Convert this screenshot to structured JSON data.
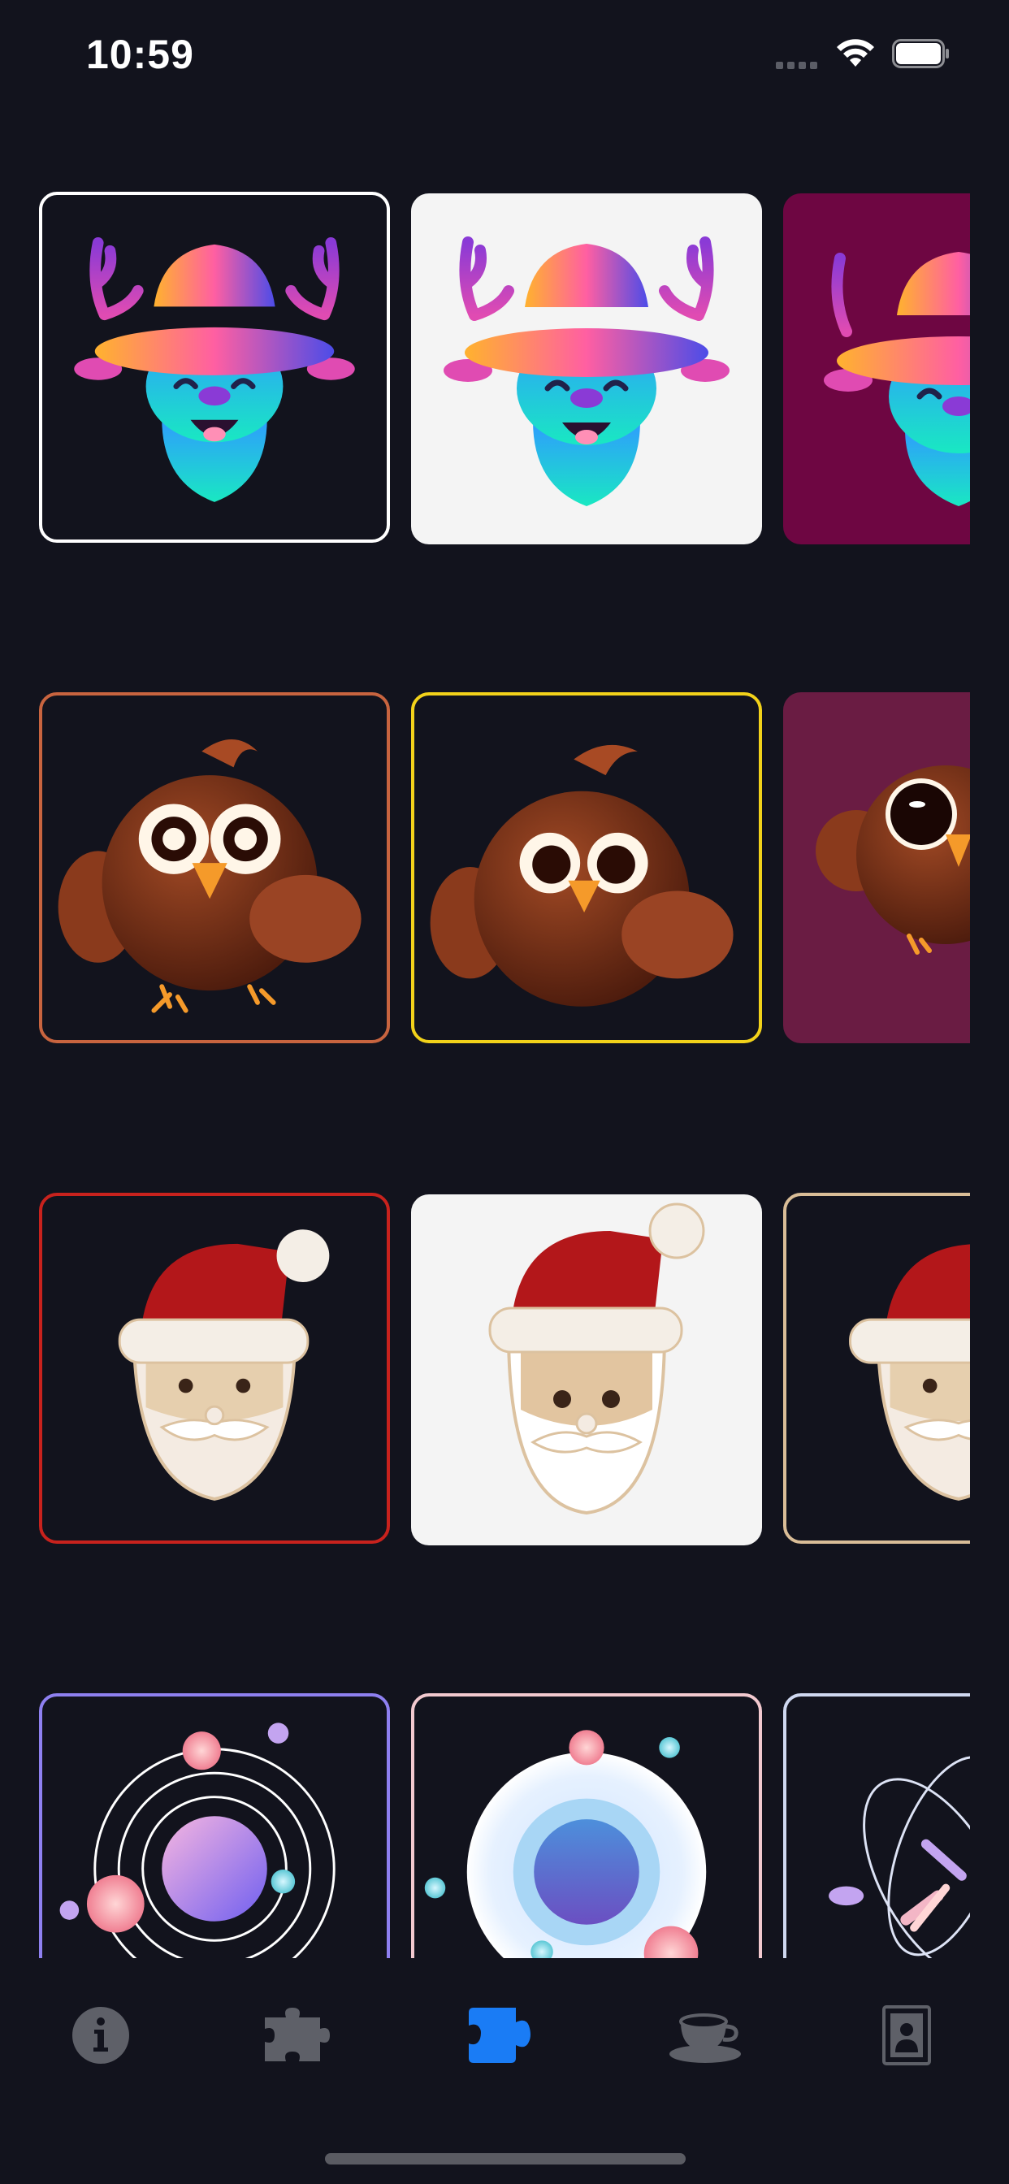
{
  "status_bar": {
    "time": "10:59"
  },
  "tab_bar": {
    "tabs": [
      {
        "icon": "info-icon",
        "active": false
      },
      {
        "icon": "puzzle-icon",
        "active": false
      },
      {
        "icon": "puzzle-icon",
        "active": true
      },
      {
        "icon": "coffee-cup-icon",
        "active": false
      },
      {
        "icon": "portrait-frame-icon",
        "active": false
      }
    ]
  },
  "colors": {
    "background": "#12131d",
    "active_tab": "#1a7cf5",
    "inactive_tab": "#5e6068"
  },
  "grid": {
    "rows": [
      {
        "subject": "deer-with-hat",
        "tiles": [
          {
            "background": "#12131d",
            "border": "#ffffff",
            "selected": true
          },
          {
            "background": "#f4f4f4",
            "border": "none",
            "selected": false
          },
          {
            "background": "#6e0642",
            "border": "none",
            "selected": false
          }
        ]
      },
      {
        "subject": "owl",
        "tiles": [
          {
            "background": "#12131d",
            "border": "#c8643f",
            "selected": false
          },
          {
            "background": "#12131d",
            "border": "#f2d21a",
            "selected": false
          },
          {
            "background": "#6a1c43",
            "border": "none",
            "selected": false
          }
        ]
      },
      {
        "subject": "santa-claus",
        "tiles": [
          {
            "background": "#12131d",
            "border": "#c8221d",
            "selected": false
          },
          {
            "background": "#f4f4f4",
            "border": "none",
            "selected": false
          },
          {
            "background": "#12131d",
            "border": "#d9bd97",
            "selected": false
          }
        ]
      },
      {
        "subject": "planet-orbit",
        "tiles": [
          {
            "background": "#12131d",
            "border": "#8e80f0",
            "selected": false
          },
          {
            "background": "#12131d",
            "border": "#f2c9cf",
            "selected": false
          },
          {
            "background": "#12131d",
            "border": "#cfd8f0",
            "selected": false
          }
        ]
      }
    ]
  }
}
